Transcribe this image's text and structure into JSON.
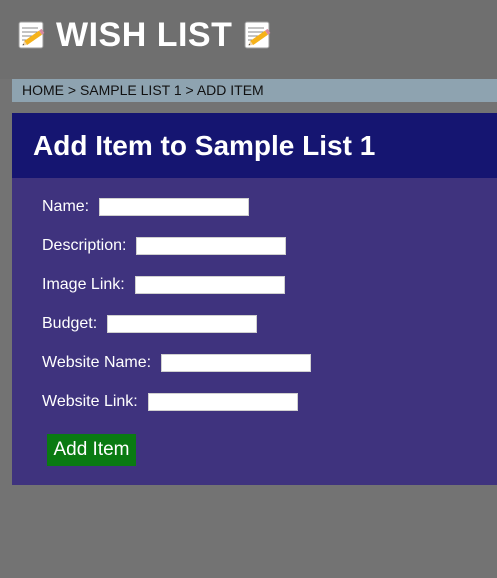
{
  "header": {
    "title": "WISH LIST",
    "left_icon": "memo-icon",
    "right_icon": "memo-icon"
  },
  "breadcrumb": {
    "text": "HOME > SAMPLE LIST 1 > ADD ITEM"
  },
  "panel": {
    "title": "Add Item to Sample List 1"
  },
  "form": {
    "fields": [
      {
        "label": "Name:",
        "value": "",
        "placeholder": ""
      },
      {
        "label": "Description:",
        "value": "",
        "placeholder": ""
      },
      {
        "label": "Image Link:",
        "value": "",
        "placeholder": ""
      },
      {
        "label": "Budget:",
        "value": "",
        "placeholder": ""
      },
      {
        "label": "Website Name:",
        "value": "",
        "placeholder": ""
      },
      {
        "label": "Website Link:",
        "value": "",
        "placeholder": ""
      }
    ],
    "submit_label": "Add Item"
  },
  "colors": {
    "page_bg": "#737373",
    "header_bg": "#6f6f6f",
    "breadcrumb_bg": "#8ea3b0",
    "panel_bg": "#3f337e",
    "panel_header_bg": "#151571",
    "button_bg": "#0a7a12",
    "text_white": "#ffffff"
  }
}
